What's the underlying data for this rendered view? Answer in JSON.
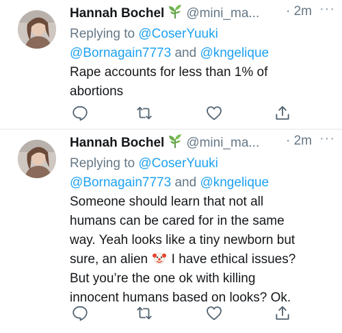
{
  "tweets": [
    {
      "display_name": "Hannah Bochel",
      "verified_badge": "sprout-icon",
      "handle": "@mini_ma...",
      "time": "· 2m",
      "more": "···",
      "replying_to_label": "Replying to",
      "mentions_line1": "@CoserYuuki",
      "mentions_line2_a": "@Bornagain7773",
      "and_label": "and",
      "mentions_line2_b": "@kngelique",
      "body_lines": [
        "Rape accounts for less than 1% of",
        "abortions"
      ]
    },
    {
      "display_name": "Hannah Bochel",
      "verified_badge": "sprout-icon",
      "handle": "@mini_ma...",
      "time": "· 2m",
      "more": "···",
      "replying_to_label": "Replying to",
      "mentions_line1": "@CoserYuuki",
      "mentions_line2_a": "@Bornagain7773",
      "and_label": "and",
      "mentions_line2_b": "@kngelique",
      "body_lines": [
        "Someone should learn that not all",
        "humans can be cared for in the same",
        "way. Yeah looks like a tiny newborn but",
        "sure, an alien",
        "I have ethical issues?",
        "But you’re  the one ok with killing",
        "innocent humans based on looks? Ok."
      ]
    }
  ],
  "colors": {
    "link": "#1da1f2",
    "muted": "#657786",
    "text": "#14171a"
  },
  "icons": [
    "reply-icon",
    "retweet-icon",
    "like-icon",
    "share-icon",
    "clown-emoji"
  ]
}
